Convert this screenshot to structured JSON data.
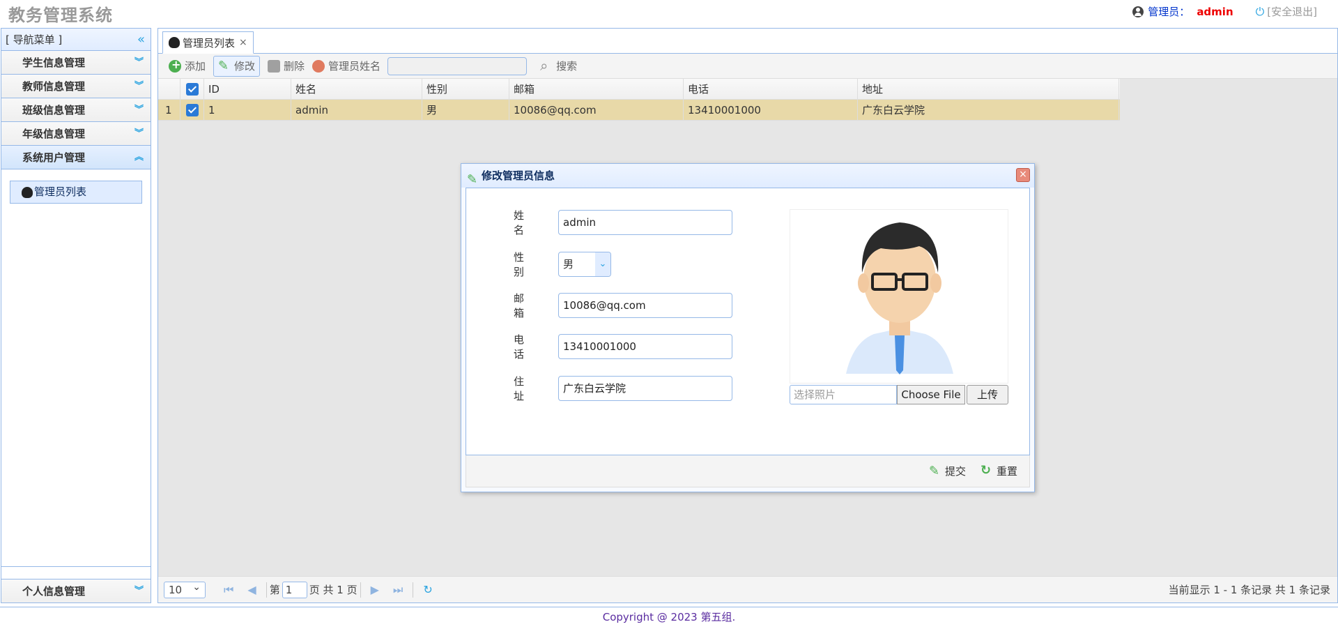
{
  "header": {
    "title": "教务管理系统",
    "role_label": "管理员：",
    "user": "admin",
    "logout": "[安全退出]"
  },
  "nav": {
    "header": "[ 导航菜单 ]",
    "items": [
      {
        "label": "学生信息管理"
      },
      {
        "label": "教师信息管理"
      },
      {
        "label": "班级信息管理"
      },
      {
        "label": "年级信息管理"
      },
      {
        "label": "系统用户管理"
      }
    ],
    "sub_item": "管理员列表",
    "bottom_item": "个人信息管理"
  },
  "tabs": [
    {
      "label": "管理员列表",
      "close": "×"
    }
  ],
  "toolbar": {
    "add": "添加",
    "edit": "修改",
    "delete": "删除",
    "name_filter_label": "管理员姓名",
    "search": "搜索"
  },
  "grid": {
    "columns": [
      "ID",
      "姓名",
      "性别",
      "邮箱",
      "电话",
      "地址"
    ],
    "rows": [
      {
        "num": "1",
        "id": "1",
        "name": "admin",
        "sex": "男",
        "email": "10086@qq.com",
        "phone": "13410001000",
        "address": "广东白云学院"
      }
    ]
  },
  "pager": {
    "page_size": "10",
    "page_prefix": "第",
    "page_value": "1",
    "page_suffix": "页 共 1 页",
    "info": "当前显示 1 - 1 条记录 共 1 条记录"
  },
  "dialog": {
    "title": "修改管理员信息",
    "close": "×",
    "fields": {
      "name_label": "姓名",
      "name_value": "admin",
      "sex_label": "性别",
      "sex_value": "男",
      "email_label": "邮箱",
      "email_value": "10086@qq.com",
      "phone_label": "电话",
      "phone_value": "13410001000",
      "address_label": "住址",
      "address_value": "广东白云学院"
    },
    "photo_placeholder": "选择照片",
    "choose_file": "Choose File",
    "upload": "上传",
    "submit": "提交",
    "reset": "重置"
  },
  "footer": {
    "copyright": "Copyright @ 2023 第五组."
  },
  "colors": {
    "accent": "#95b8e7",
    "selected_row": "#e8d9a8",
    "brand_red": "#ee0000"
  }
}
